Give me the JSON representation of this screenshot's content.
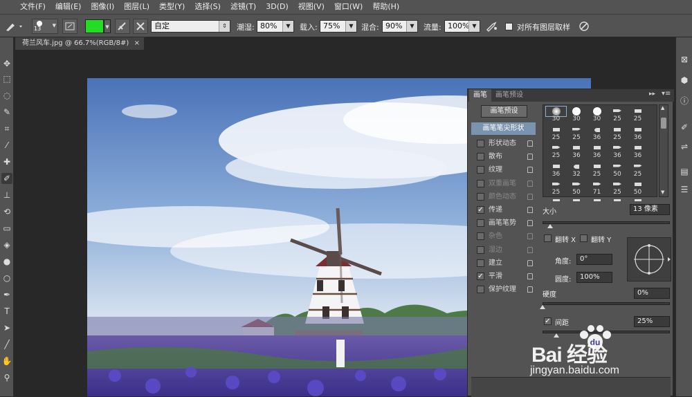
{
  "menu": [
    "文件(F)",
    "编辑(E)",
    "图像(I)",
    "图层(L)",
    "类型(Y)",
    "选择(S)",
    "滤镜(T)",
    "3D(D)",
    "视图(V)",
    "窗口(W)",
    "帮助(H)"
  ],
  "options": {
    "brush_size": "13",
    "foreground_color": "#22dd22",
    "mode_value": "自定",
    "opacity_label": "潮湿:",
    "opacity_value": "80%",
    "load_label": "载入:",
    "load_value": "75%",
    "mix_label": "混合:",
    "mix_value": "90%",
    "flow_label": "流量:",
    "flow_value": "100%",
    "sample_all_label": "对所有图层取样"
  },
  "document_tab": {
    "title": "荷兰风车.jpg @ 66.7%(RGB/8#)",
    "close": "×"
  },
  "brush_panel": {
    "tab_brush": "画笔",
    "tab_presets": "画笔预设",
    "preset_button": "画笔预设",
    "tip_shape": "画笔笔尖形状",
    "options": [
      {
        "label": "形状动态",
        "checked": false,
        "disabled": false
      },
      {
        "label": "散布",
        "checked": false,
        "disabled": false
      },
      {
        "label": "纹理",
        "checked": false,
        "disabled": false
      },
      {
        "label": "双重画笔",
        "checked": false,
        "disabled": true
      },
      {
        "label": "颜色动态",
        "checked": false,
        "disabled": true
      },
      {
        "label": "传递",
        "checked": true,
        "disabled": false
      },
      {
        "label": "画笔笔势",
        "checked": false,
        "disabled": false
      },
      {
        "label": "杂色",
        "checked": false,
        "disabled": true
      },
      {
        "label": "湿边",
        "checked": false,
        "disabled": true
      },
      {
        "label": "建立",
        "checked": false,
        "disabled": false
      },
      {
        "label": "平滑",
        "checked": true,
        "disabled": false
      },
      {
        "label": "保护纹理",
        "checked": false,
        "disabled": false
      }
    ],
    "brush_sizes": [
      [
        "30",
        "30",
        "30",
        "25",
        "25"
      ],
      [
        "25",
        "25",
        "36",
        "25",
        "36"
      ],
      [
        "25",
        "36",
        "36",
        "36",
        "36"
      ],
      [
        "36",
        "32",
        "25",
        "50",
        "25"
      ],
      [
        "25",
        "50",
        "71",
        "25",
        "50"
      ]
    ],
    "size_label": "大小",
    "size_value": "13 像素",
    "flip_x": "翻转 X",
    "flip_y": "翻转 Y",
    "angle_label": "角度:",
    "angle_value": "0°",
    "roundness_label": "圆度:",
    "roundness_value": "100%",
    "hardness_label": "硬度",
    "hardness_value": "0%",
    "spacing_label": "间距",
    "spacing_value": "25%"
  },
  "watermark": {
    "brand": "Bai 经验",
    "url": "jingyan.baidu.com"
  }
}
